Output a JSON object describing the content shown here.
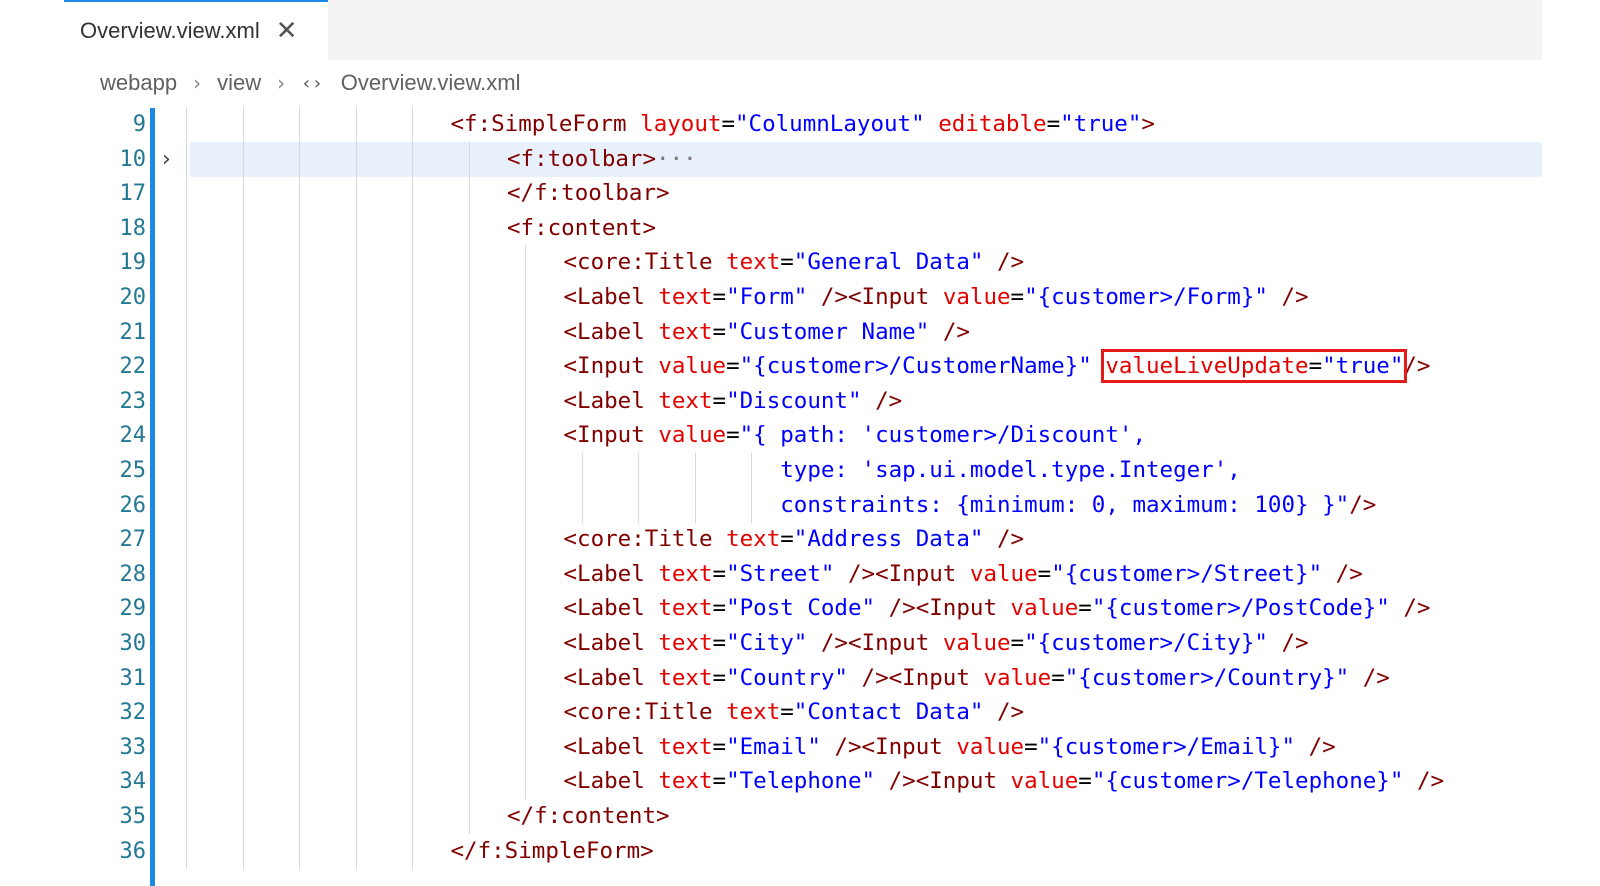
{
  "tab": {
    "title": "Overview.view.xml",
    "close_glyph": "✕"
  },
  "breadcrumb": [
    {
      "label": "webapp"
    },
    {
      "label": "view"
    },
    {
      "label": "Overview.view.xml",
      "icon": "xml-code-icon"
    }
  ],
  "editor": {
    "highlighted_line": "10",
    "lines": [
      {
        "n": "9",
        "indent": 5,
        "tokens": [
          {
            "c": "t",
            "v": "<f:SimpleForm"
          },
          {
            "c": "p",
            "v": " "
          },
          {
            "c": "a",
            "v": "layout"
          },
          {
            "c": "p",
            "v": "="
          },
          {
            "c": "s",
            "v": "\"ColumnLayout\""
          },
          {
            "c": "p",
            "v": " "
          },
          {
            "c": "a",
            "v": "editable"
          },
          {
            "c": "p",
            "v": "="
          },
          {
            "c": "s",
            "v": "\"true\""
          },
          {
            "c": "t",
            "v": ">"
          }
        ]
      },
      {
        "n": "10",
        "indent": 6,
        "fold": "›",
        "tokens": [
          {
            "c": "t",
            "v": "<f:toolbar>"
          },
          {
            "c": "ell",
            "v": "···"
          }
        ]
      },
      {
        "n": "17",
        "indent": 6,
        "tokens": [
          {
            "c": "t",
            "v": "</f:toolbar>"
          }
        ]
      },
      {
        "n": "18",
        "indent": 6,
        "tokens": [
          {
            "c": "t",
            "v": "<f:content>"
          }
        ]
      },
      {
        "n": "19",
        "indent": 7,
        "tokens": [
          {
            "c": "t",
            "v": "<core:Title"
          },
          {
            "c": "p",
            "v": " "
          },
          {
            "c": "a",
            "v": "text"
          },
          {
            "c": "p",
            "v": "="
          },
          {
            "c": "s",
            "v": "\"General Data\""
          },
          {
            "c": "p",
            "v": " "
          },
          {
            "c": "t",
            "v": "/>"
          }
        ]
      },
      {
        "n": "20",
        "indent": 7,
        "tokens": [
          {
            "c": "t",
            "v": "<Label"
          },
          {
            "c": "p",
            "v": " "
          },
          {
            "c": "a",
            "v": "text"
          },
          {
            "c": "p",
            "v": "="
          },
          {
            "c": "s",
            "v": "\"Form\""
          },
          {
            "c": "p",
            "v": " "
          },
          {
            "c": "t",
            "v": "/><Input"
          },
          {
            "c": "p",
            "v": " "
          },
          {
            "c": "a",
            "v": "value"
          },
          {
            "c": "p",
            "v": "="
          },
          {
            "c": "s",
            "v": "\"{customer>/Form}\""
          },
          {
            "c": "p",
            "v": " "
          },
          {
            "c": "t",
            "v": "/>"
          }
        ]
      },
      {
        "n": "21",
        "indent": 7,
        "tokens": [
          {
            "c": "t",
            "v": "<Label"
          },
          {
            "c": "p",
            "v": " "
          },
          {
            "c": "a",
            "v": "text"
          },
          {
            "c": "p",
            "v": "="
          },
          {
            "c": "s",
            "v": "\"Customer Name\""
          },
          {
            "c": "p",
            "v": " "
          },
          {
            "c": "t",
            "v": "/>"
          }
        ]
      },
      {
        "n": "22",
        "indent": 7,
        "tokens": [
          {
            "c": "t",
            "v": "<Input"
          },
          {
            "c": "p",
            "v": " "
          },
          {
            "c": "a",
            "v": "value"
          },
          {
            "c": "p",
            "v": "="
          },
          {
            "c": "s",
            "v": "\"{customer>/CustomerName}\""
          },
          {
            "c": "p",
            "v": " "
          },
          {
            "c": "a",
            "v": "valueLiveUpdate",
            "box": "start"
          },
          {
            "c": "p",
            "v": "="
          },
          {
            "c": "s",
            "v": "\"true\"",
            "box": "end"
          },
          {
            "c": "t",
            "v": "/>"
          }
        ]
      },
      {
        "n": "23",
        "indent": 7,
        "tokens": [
          {
            "c": "t",
            "v": "<Label"
          },
          {
            "c": "p",
            "v": " "
          },
          {
            "c": "a",
            "v": "text"
          },
          {
            "c": "p",
            "v": "="
          },
          {
            "c": "s",
            "v": "\"Discount\""
          },
          {
            "c": "p",
            "v": " "
          },
          {
            "c": "t",
            "v": "/>"
          }
        ]
      },
      {
        "n": "24",
        "indent": 7,
        "tokens": [
          {
            "c": "t",
            "v": "<Input"
          },
          {
            "c": "p",
            "v": " "
          },
          {
            "c": "a",
            "v": "value"
          },
          {
            "c": "p",
            "v": "="
          },
          {
            "c": "s",
            "v": "\"{ path: 'customer>/Discount',"
          }
        ]
      },
      {
        "n": "25",
        "indent": 7,
        "extra_guides": 4,
        "tokens": [
          {
            "c": "p",
            "v": "                "
          },
          {
            "c": "s",
            "v": "type: 'sap.ui.model.type.Integer',"
          }
        ]
      },
      {
        "n": "26",
        "indent": 7,
        "extra_guides": 4,
        "tokens": [
          {
            "c": "p",
            "v": "                "
          },
          {
            "c": "s",
            "v": "constraints: {minimum: 0, maximum: 100} }\""
          },
          {
            "c": "t",
            "v": "/>"
          }
        ]
      },
      {
        "n": "27",
        "indent": 7,
        "tokens": [
          {
            "c": "t",
            "v": "<core:Title"
          },
          {
            "c": "p",
            "v": " "
          },
          {
            "c": "a",
            "v": "text"
          },
          {
            "c": "p",
            "v": "="
          },
          {
            "c": "s",
            "v": "\"Address Data\""
          },
          {
            "c": "p",
            "v": " "
          },
          {
            "c": "t",
            "v": "/>"
          }
        ]
      },
      {
        "n": "28",
        "indent": 7,
        "tokens": [
          {
            "c": "t",
            "v": "<Label"
          },
          {
            "c": "p",
            "v": " "
          },
          {
            "c": "a",
            "v": "text"
          },
          {
            "c": "p",
            "v": "="
          },
          {
            "c": "s",
            "v": "\"Street\""
          },
          {
            "c": "p",
            "v": " "
          },
          {
            "c": "t",
            "v": "/><Input"
          },
          {
            "c": "p",
            "v": " "
          },
          {
            "c": "a",
            "v": "value"
          },
          {
            "c": "p",
            "v": "="
          },
          {
            "c": "s",
            "v": "\"{customer>/Street}\""
          },
          {
            "c": "p",
            "v": " "
          },
          {
            "c": "t",
            "v": "/>"
          }
        ]
      },
      {
        "n": "29",
        "indent": 7,
        "tokens": [
          {
            "c": "t",
            "v": "<Label"
          },
          {
            "c": "p",
            "v": " "
          },
          {
            "c": "a",
            "v": "text"
          },
          {
            "c": "p",
            "v": "="
          },
          {
            "c": "s",
            "v": "\"Post Code\""
          },
          {
            "c": "p",
            "v": " "
          },
          {
            "c": "t",
            "v": "/><Input"
          },
          {
            "c": "p",
            "v": " "
          },
          {
            "c": "a",
            "v": "value"
          },
          {
            "c": "p",
            "v": "="
          },
          {
            "c": "s",
            "v": "\"{customer>/PostCode}\""
          },
          {
            "c": "p",
            "v": " "
          },
          {
            "c": "t",
            "v": "/>"
          }
        ]
      },
      {
        "n": "30",
        "indent": 7,
        "tokens": [
          {
            "c": "t",
            "v": "<Label"
          },
          {
            "c": "p",
            "v": " "
          },
          {
            "c": "a",
            "v": "text"
          },
          {
            "c": "p",
            "v": "="
          },
          {
            "c": "s",
            "v": "\"City\""
          },
          {
            "c": "p",
            "v": " "
          },
          {
            "c": "t",
            "v": "/><Input"
          },
          {
            "c": "p",
            "v": " "
          },
          {
            "c": "a",
            "v": "value"
          },
          {
            "c": "p",
            "v": "="
          },
          {
            "c": "s",
            "v": "\"{customer>/City}\""
          },
          {
            "c": "p",
            "v": " "
          },
          {
            "c": "t",
            "v": "/>"
          }
        ]
      },
      {
        "n": "31",
        "indent": 7,
        "tokens": [
          {
            "c": "t",
            "v": "<Label"
          },
          {
            "c": "p",
            "v": " "
          },
          {
            "c": "a",
            "v": "text"
          },
          {
            "c": "p",
            "v": "="
          },
          {
            "c": "s",
            "v": "\"Country\""
          },
          {
            "c": "p",
            "v": " "
          },
          {
            "c": "t",
            "v": "/><Input"
          },
          {
            "c": "p",
            "v": " "
          },
          {
            "c": "a",
            "v": "value"
          },
          {
            "c": "p",
            "v": "="
          },
          {
            "c": "s",
            "v": "\"{customer>/Country}\""
          },
          {
            "c": "p",
            "v": " "
          },
          {
            "c": "t",
            "v": "/>"
          }
        ]
      },
      {
        "n": "32",
        "indent": 7,
        "tokens": [
          {
            "c": "t",
            "v": "<core:Title"
          },
          {
            "c": "p",
            "v": " "
          },
          {
            "c": "a",
            "v": "text"
          },
          {
            "c": "p",
            "v": "="
          },
          {
            "c": "s",
            "v": "\"Contact Data\""
          },
          {
            "c": "p",
            "v": " "
          },
          {
            "c": "t",
            "v": "/>"
          }
        ]
      },
      {
        "n": "33",
        "indent": 7,
        "tokens": [
          {
            "c": "t",
            "v": "<Label"
          },
          {
            "c": "p",
            "v": " "
          },
          {
            "c": "a",
            "v": "text"
          },
          {
            "c": "p",
            "v": "="
          },
          {
            "c": "s",
            "v": "\"Email\""
          },
          {
            "c": "p",
            "v": " "
          },
          {
            "c": "t",
            "v": "/><Input"
          },
          {
            "c": "p",
            "v": " "
          },
          {
            "c": "a",
            "v": "value"
          },
          {
            "c": "p",
            "v": "="
          },
          {
            "c": "s",
            "v": "\"{customer>/Email}\""
          },
          {
            "c": "p",
            "v": " "
          },
          {
            "c": "t",
            "v": "/>"
          }
        ]
      },
      {
        "n": "34",
        "indent": 7,
        "tokens": [
          {
            "c": "t",
            "v": "<Label"
          },
          {
            "c": "p",
            "v": " "
          },
          {
            "c": "a",
            "v": "text"
          },
          {
            "c": "p",
            "v": "="
          },
          {
            "c": "s",
            "v": "\"Telephone\""
          },
          {
            "c": "p",
            "v": " "
          },
          {
            "c": "t",
            "v": "/><Input"
          },
          {
            "c": "p",
            "v": " "
          },
          {
            "c": "a",
            "v": "value"
          },
          {
            "c": "p",
            "v": "="
          },
          {
            "c": "s",
            "v": "\"{customer>/Telephone}\""
          },
          {
            "c": "p",
            "v": " "
          },
          {
            "c": "t",
            "v": "/>"
          }
        ]
      },
      {
        "n": "35",
        "indent": 6,
        "tokens": [
          {
            "c": "t",
            "v": "</f:content>"
          }
        ]
      },
      {
        "n": "36",
        "indent": 5,
        "tokens": [
          {
            "c": "t",
            "v": "</f:SimpleForm>"
          }
        ]
      }
    ]
  }
}
